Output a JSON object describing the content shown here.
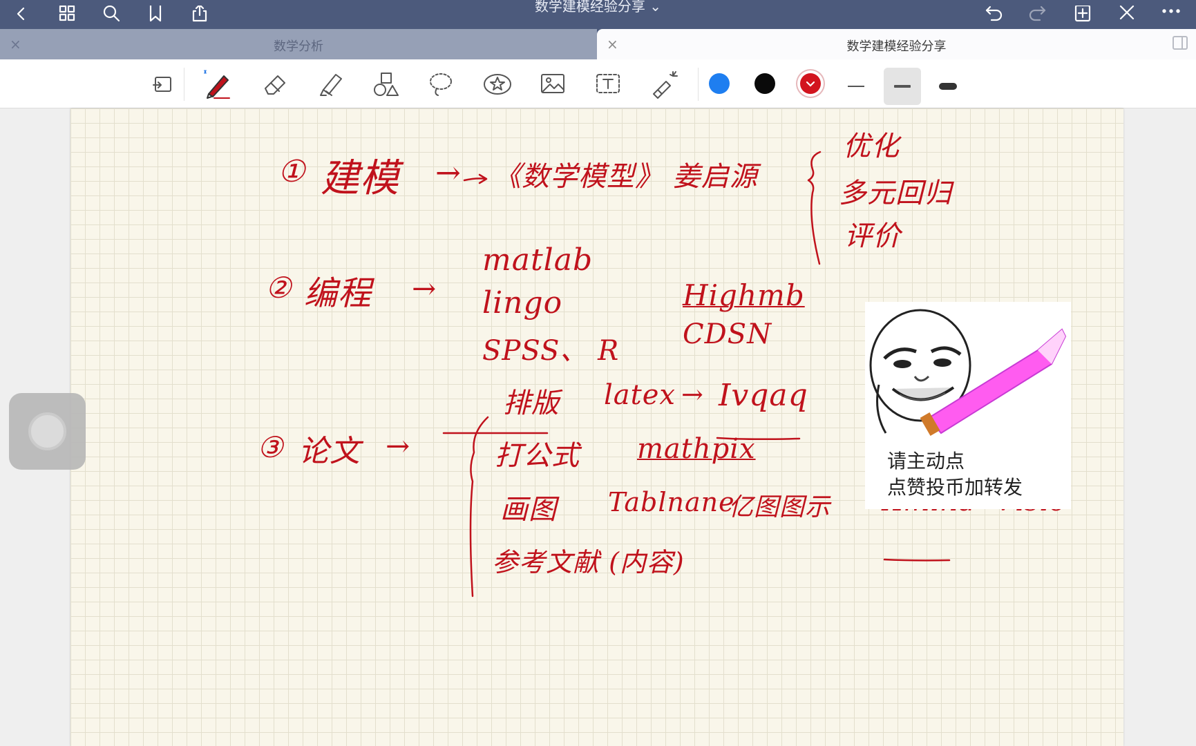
{
  "window": {
    "doc_title": "数学建模经验分享 ⌄"
  },
  "tabs": [
    {
      "label": "数学分析",
      "active": false,
      "close": "×"
    },
    {
      "label": "数学建模经验分享",
      "active": true,
      "close": "×"
    }
  ],
  "toolbar": {
    "colors": [
      "#1e7ef0",
      "#0a0a0a",
      "#d2141e"
    ],
    "selected_color": "#d2141e",
    "selected_thickness": "medium"
  },
  "note": {
    "line1": {
      "num": "①",
      "word": "建模",
      "arrow": "→",
      "source": "《数学模型》 姜启源"
    },
    "list1": [
      "优化",
      "多元回归",
      "评价"
    ],
    "line2": {
      "num": "②",
      "word": "编程",
      "arrow": "→"
    },
    "tools": [
      "matlab",
      "lingo",
      "SPSS、 R"
    ],
    "sites": [
      "Highmb",
      "CDSN"
    ],
    "line3": {
      "num": "③",
      "word": "论文",
      "arrow": "→"
    },
    "typeset": {
      "label": "排版",
      "tool": "latex",
      "arrow": "→",
      "target": "Ivqaq"
    },
    "formula": {
      "label": "打公式",
      "tool": "mathpix"
    },
    "draw": {
      "label": "画图",
      "tools": [
        "Tablnane",
        "亿图图示",
        "Xmind",
        "Visio"
      ]
    },
    "refs": "参考文献 (内容)"
  },
  "sticker": {
    "caption_line1": "请主动点",
    "caption_line2": "点赞投币加转发"
  }
}
